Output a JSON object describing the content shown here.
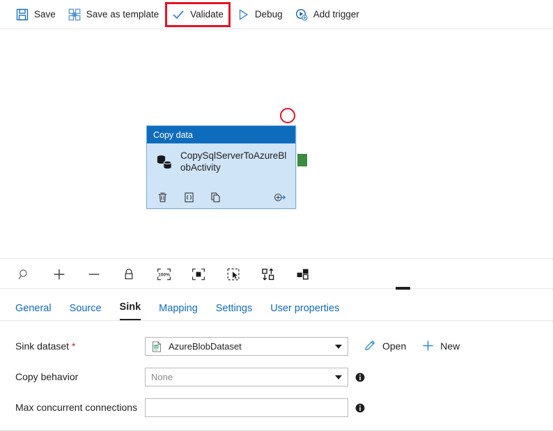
{
  "toolbar": {
    "items": [
      {
        "label": "Save",
        "icon": "save-icon",
        "highlighted": false
      },
      {
        "label": "Save as template",
        "icon": "template-icon",
        "highlighted": false
      },
      {
        "label": "Validate",
        "icon": "checkmark-icon",
        "highlighted": true
      },
      {
        "label": "Debug",
        "icon": "play-triangle-icon",
        "highlighted": false
      },
      {
        "label": "Add trigger",
        "icon": "add-trigger-icon",
        "highlighted": false
      }
    ],
    "highlight_color": "#e81123",
    "accent_color": "#0f6cbd"
  },
  "canvas": {
    "annotation": {
      "shape": "circle",
      "color": "#e81123"
    },
    "node": {
      "header": "Copy data",
      "title": "CopySqlServerToAzureBlobActivity",
      "icon": "database-copy-icon",
      "header_color": "#0f6cbd",
      "body_color": "#cfe4f7",
      "port_color": "#3d8b40",
      "actions": [
        {
          "name": "delete-icon",
          "label": "Delete"
        },
        {
          "name": "code-brackets-icon",
          "label": "Code"
        },
        {
          "name": "duplicate-icon",
          "label": "Clone"
        },
        {
          "name": "add-output-icon",
          "label": "Add output"
        }
      ]
    },
    "toolbar_buttons": [
      {
        "name": "zoom-search-icon",
        "label": "Zoom"
      },
      {
        "name": "zoom-in-icon",
        "label": "Zoom in"
      },
      {
        "name": "zoom-out-icon",
        "label": "Zoom out"
      },
      {
        "name": "lock-icon",
        "label": "Lock"
      },
      {
        "name": "zoom-100-icon",
        "label": "100%"
      },
      {
        "name": "fit-to-screen-icon",
        "label": "Fit to screen"
      },
      {
        "name": "select-area-icon",
        "label": "Select"
      },
      {
        "name": "auto-align-icon",
        "label": "Auto align"
      },
      {
        "name": "layout-icon",
        "label": "Layout"
      }
    ],
    "zoom_level_label": "100%"
  },
  "tabs": [
    {
      "label": "General",
      "active": false
    },
    {
      "label": "Source",
      "active": false
    },
    {
      "label": "Sink",
      "active": true
    },
    {
      "label": "Mapping",
      "active": false
    },
    {
      "label": "Settings",
      "active": false
    },
    {
      "label": "User properties",
      "active": false
    }
  ],
  "form": {
    "sink_dataset": {
      "label": "Sink dataset",
      "required_marker": "*",
      "value": "AzureBlobDataset",
      "icon": "csv-dataset-icon",
      "open_label": "Open",
      "new_label": "New"
    },
    "copy_behavior": {
      "label": "Copy behavior",
      "value": "None",
      "is_placeholder": true
    },
    "max_concurrent_connections": {
      "label": "Max concurrent connections",
      "value": "",
      "placeholder": ""
    }
  }
}
